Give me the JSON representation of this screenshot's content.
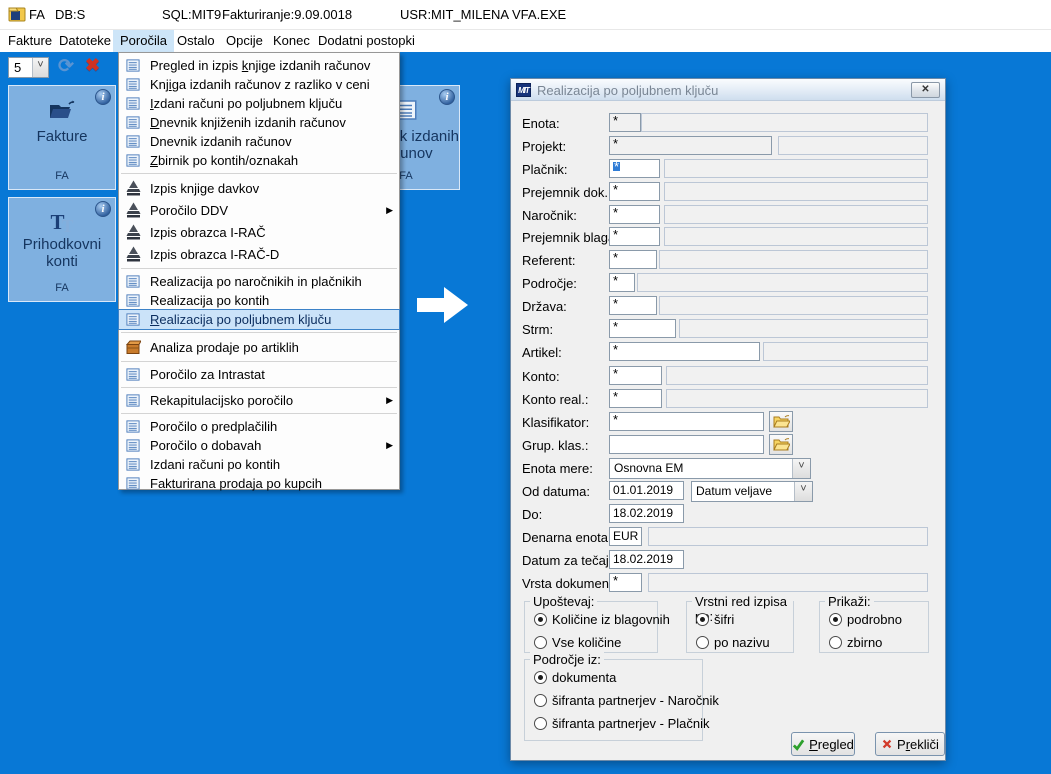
{
  "titlebar": {
    "app_code": "FA",
    "db": "DB:S",
    "sql": "SQL:MIT9",
    "app_version": "Fakturiranje:9.09.0018",
    "user": "USR:MIT_MILENA",
    "exe": "VFA.EXE"
  },
  "menubar": {
    "items": [
      {
        "label": "Fakture",
        "selected": false
      },
      {
        "label": "Datoteke",
        "selected": false
      },
      {
        "label": "Poročila",
        "selected": true
      },
      {
        "label": "Ostalo",
        "selected": false
      },
      {
        "label": "Opcije",
        "selected": false
      },
      {
        "label": "Konec",
        "selected": false
      },
      {
        "label": "Dodatni postopki",
        "selected": false
      }
    ]
  },
  "toolbar": {
    "tile_count": "5",
    "refresh_icon": "refresh-icon",
    "delete_icon": "red-x-icon"
  },
  "tiles": [
    {
      "title": "Fakture",
      "code": "FA",
      "icon": "open-folder-icon"
    },
    {
      "title": "Prihodkovni konti",
      "code": "FA",
      "icon": "tt-letters-icon"
    },
    {
      "title": "Dnevnik izdanih računov",
      "code": "FA",
      "icon": "report-icon"
    }
  ],
  "menu": {
    "items": [
      {
        "icon": "report-icon",
        "pre": "Pregled in izpis ",
        "u": "k",
        "post": "njige izdanih računov"
      },
      {
        "icon": "report-icon",
        "pre": "Knj",
        "u": "i",
        "post": "ga izdanih računov z razliko v ceni"
      },
      {
        "icon": "report-icon",
        "pre": "",
        "u": "I",
        "post": "zdani računi po poljubnem ključu"
      },
      {
        "icon": "report-icon",
        "pre": "",
        "u": "D",
        "post": "nevnik knjiženih izdanih računov"
      },
      {
        "icon": "report-icon",
        "pre": "Dnevnik izdanih računov",
        "u": "",
        "post": ""
      },
      {
        "icon": "report-icon",
        "pre": "",
        "u": "Z",
        "post": "birnik po kontih/oznakah"
      },
      {
        "icon": "durs-pyramid-icon",
        "pre": "Izpis knjige davkov",
        "u": "",
        "post": "",
        "sep_before": true,
        "tall": true
      },
      {
        "icon": "durs-pyramid-icon",
        "pre": "Poročilo DDV",
        "u": "",
        "post": "",
        "submenu": true,
        "tall": true
      },
      {
        "icon": "durs-pyramid-icon",
        "pre": "Izpis obrazca I-RAČ",
        "u": "",
        "post": "",
        "tall": true
      },
      {
        "icon": "durs-pyramid-icon",
        "pre": "Izpis obrazca I-RAČ-D",
        "u": "",
        "post": "",
        "tall": true
      },
      {
        "icon": "report-icon",
        "pre": "Realizacija po naročnikih in plačnikih",
        "u": "",
        "post": "",
        "sep_before": true
      },
      {
        "icon": "report-icon",
        "pre": "Realizacija po kontih",
        "u": "",
        "post": ""
      },
      {
        "icon": "report-icon",
        "pre": "",
        "u": "R",
        "post": "ealizacija po poljubnem ključu",
        "selected": true
      },
      {
        "icon": "box-icon",
        "pre": "Analiza prodaje po artiklih",
        "u": "",
        "post": "",
        "sep_before": true,
        "tall": true
      },
      {
        "icon": "report-icon",
        "pre": "Poročilo za Intrastat",
        "u": "",
        "post": "",
        "sep_before": true
      },
      {
        "icon": "report-icon",
        "pre": "Rekapitulacijsko poročilo",
        "u": "",
        "post": "",
        "submenu": true,
        "sep_before": true
      },
      {
        "icon": "report-icon",
        "pre": "Poročilo o predplačilih",
        "u": "",
        "post": "",
        "sep_before": true
      },
      {
        "icon": "report-icon",
        "pre": "Poročilo o dobavah",
        "u": "",
        "post": "",
        "submenu": true
      },
      {
        "icon": "report-icon",
        "pre": "Izdani računi po kontih",
        "u": "",
        "post": ""
      },
      {
        "icon": "report-icon",
        "pre": "Fakturirana prodaja po kupcih",
        "u": "",
        "post": ""
      }
    ]
  },
  "dialog": {
    "title": "Realizacija po poljubnem ključu",
    "title_icon": "mit-logo-icon",
    "close_icon": "close-icon",
    "fields": [
      {
        "label": "Enota:",
        "value": "*"
      },
      {
        "label": "Projekt:",
        "value": "*"
      },
      {
        "label": "Plačnik:",
        "value": "*"
      },
      {
        "label": "Prejemnik dok.:",
        "value": "*"
      },
      {
        "label": "Naročnik:",
        "value": "*"
      },
      {
        "label": "Prejemnik blaga:",
        "value": "*"
      },
      {
        "label": "Referent:",
        "value": "*"
      },
      {
        "label": "Področje:",
        "value": "*"
      },
      {
        "label": "Država:",
        "value": "*"
      },
      {
        "label": "Strm:",
        "value": "*"
      },
      {
        "label": "Artikel:",
        "value": "*"
      },
      {
        "label": "Konto:",
        "value": "*"
      },
      {
        "label": "Konto real.:",
        "value": "*"
      },
      {
        "label": "Klasifikator:",
        "value": "*",
        "button_icon": "folder-open-icon"
      },
      {
        "label": "Grup. klas.:",
        "value": "",
        "button_icon": "folder-open-icon"
      },
      {
        "label": "Enota mere:",
        "value": "Osnovna EM"
      },
      {
        "label": "Od datuma:",
        "value": "01.01.2019",
        "combo_value": "Datum veljave"
      },
      {
        "label": "Do:",
        "value": "18.02.2019"
      },
      {
        "label": "Denarna enota:",
        "value": "EUR"
      },
      {
        "label": "Datum za tečaj:",
        "value": "18.02.2019"
      },
      {
        "label": "Vrsta dokumenta:",
        "value": "*"
      }
    ],
    "groups": [
      {
        "label": "Upoštevaj:",
        "options": [
          {
            "label": "Količine iz blagovnih",
            "selected": true
          },
          {
            "label": "Vse količine",
            "selected": false
          }
        ]
      },
      {
        "label": "Vrstni red izpisa po:",
        "options": [
          {
            "label": "šifri",
            "selected": true
          },
          {
            "label": "po nazivu",
            "selected": false
          }
        ]
      },
      {
        "label": "Prikaži:",
        "options": [
          {
            "label": "podrobno",
            "selected": true
          },
          {
            "label": "zbirno",
            "selected": false
          }
        ]
      },
      {
        "label": "Področje iz:",
        "options": [
          {
            "label": "dokumenta",
            "selected": true
          },
          {
            "label": "šifranta partnerjev - Naročnik",
            "selected": false
          },
          {
            "label": "šifranta partnerjev - Plačnik",
            "selected": false
          }
        ]
      }
    ],
    "buttons": {
      "ok": {
        "pre": "",
        "u": "P",
        "post": "regled",
        "icon": "green-check-icon"
      },
      "cancel": {
        "pre": "P",
        "u": "r",
        "post": "ekliči",
        "icon": "red-x-icon"
      }
    }
  },
  "colors": {
    "desktop_blue": "#0878d6",
    "tile_blue": "#7fb0e0",
    "menu_highlight": "#cbe3f9",
    "selection_blue": "#2f7cd6"
  }
}
